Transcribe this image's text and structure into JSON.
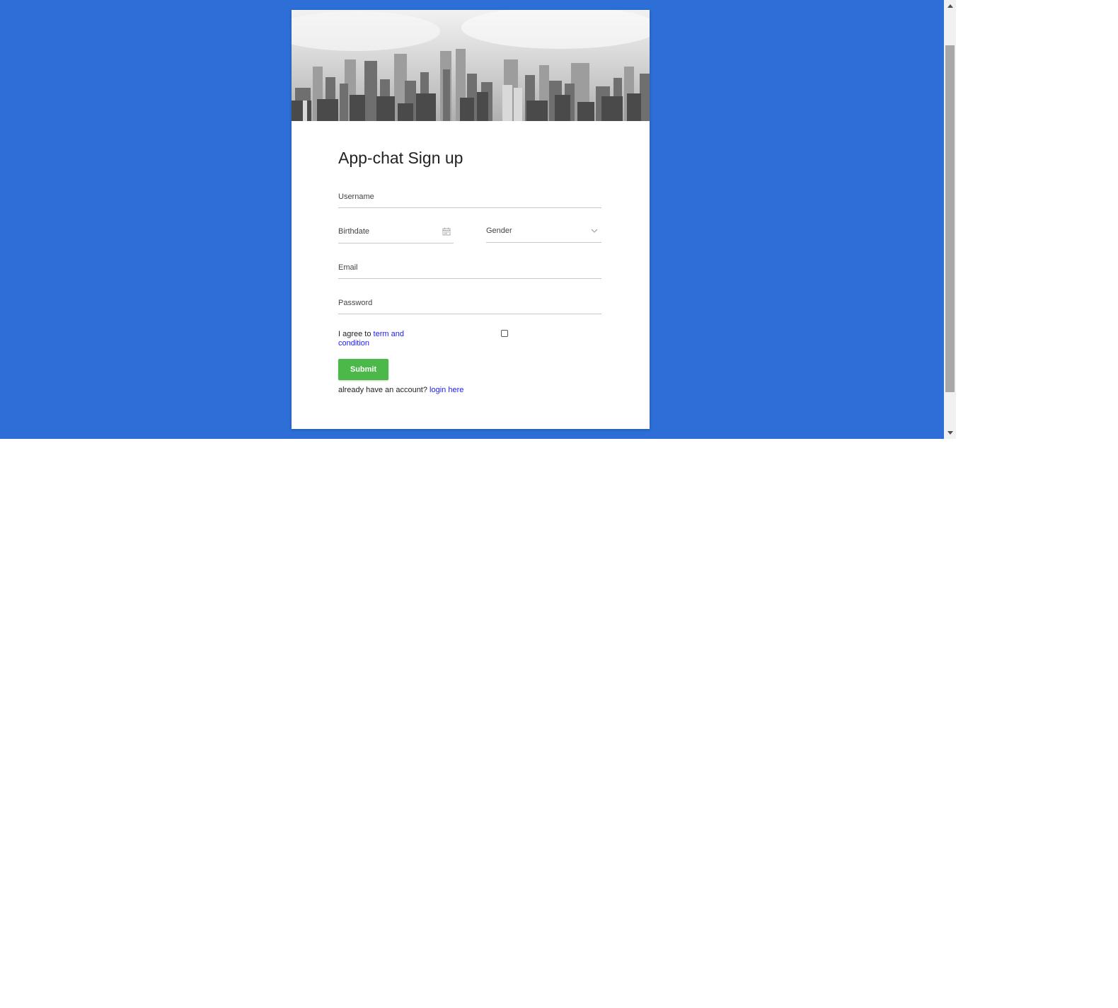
{
  "colors": {
    "page_background": "#2d6fd6",
    "submit_button": "#4cb84a",
    "link": "#1a1aff"
  },
  "form": {
    "title": "App-chat Sign up",
    "username_placeholder": "Username",
    "birthdate_label": "Birthdate",
    "gender_label": "Gender",
    "email_placeholder": "Email",
    "password_placeholder": "Password",
    "agree_prefix": "I agree to ",
    "agree_link": "term and condition",
    "agree_checked": false,
    "submit_label": "Submit",
    "login_prefix": "already have an account? ",
    "login_link": "login here"
  },
  "icons": {
    "banner": "city-skyline-image",
    "birthdate": "calendar-icon",
    "gender": "chevron-down-icon",
    "scroll_up": "scroll-up-arrow-icon",
    "scroll_down": "scroll-down-arrow-icon"
  }
}
